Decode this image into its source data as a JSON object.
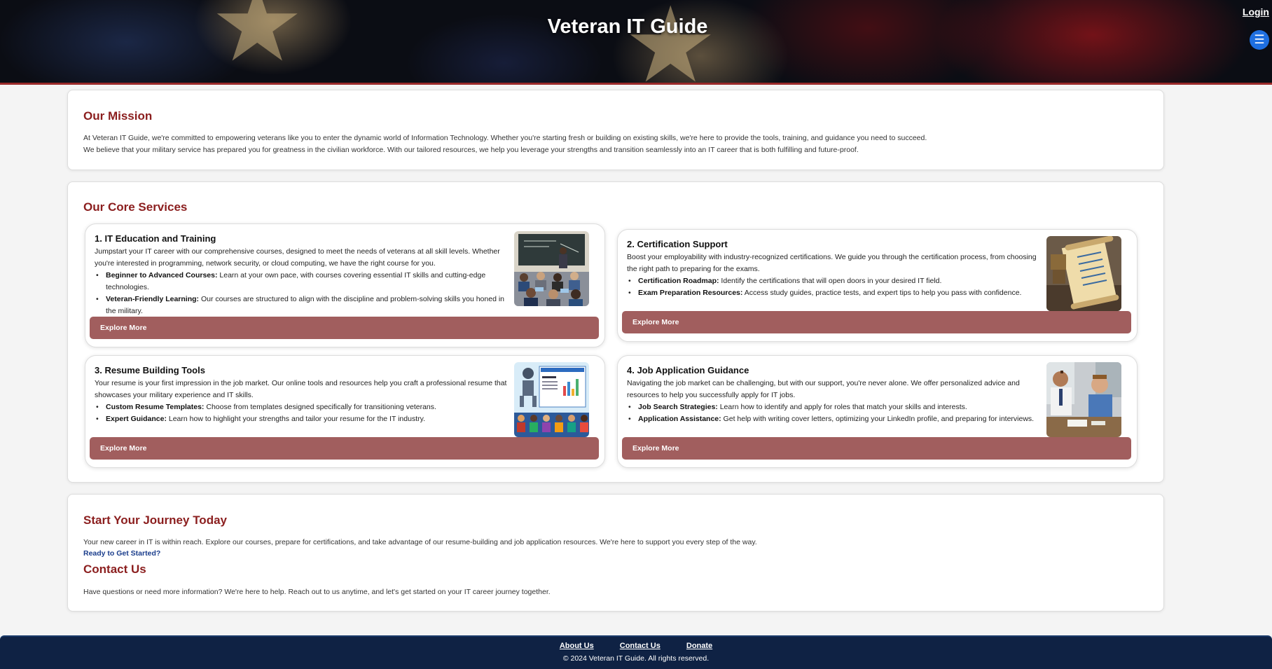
{
  "header": {
    "title": "Veteran IT Guide",
    "login_label": "Login",
    "menu_icon": "menu-icon"
  },
  "mission": {
    "title": "Our Mission",
    "paragraph1": "At Veteran IT Guide, we're committed to empowering veterans like you to enter the dynamic world of Information Technology. Whether you're starting fresh or building on existing skills, we're here to provide the tools, training, and guidance you need to succeed.",
    "paragraph2": "We believe that your military service has prepared you for greatness in the civilian workforce. With our tailored resources, we help you leverage your strengths and transition seamlessly into an IT career that is both fulfilling and future-proof."
  },
  "services": {
    "title": "Our Core Services",
    "items": [
      {
        "title": "1. IT Education and Training",
        "description": "Jumpstart your IT career with our comprehensive courses, designed to meet the needs of veterans at all skill levels. Whether you're interested in programming, network security, or cloud computing, we have the right course for you.",
        "bullets": [
          {
            "label": "Beginner to Advanced Courses:",
            "text": " Learn at your own pace, with courses covering essential IT skills and cutting-edge technologies."
          },
          {
            "label": "Veteran-Friendly Learning:",
            "text": " Our courses are structured to align with the discipline and problem-solving skills you honed in the military."
          }
        ],
        "button": "Explore More"
      },
      {
        "title": "2. Certification Support",
        "description": "Boost your employability with industry-recognized certifications. We guide you through the certification process, from choosing the right path to preparing for the exams.",
        "bullets": [
          {
            "label": "Certification Roadmap:",
            "text": " Identify the certifications that will open doors in your desired IT field."
          },
          {
            "label": "Exam Preparation Resources:",
            "text": " Access study guides, practice tests, and expert tips to help you pass with confidence."
          }
        ],
        "button": "Explore More"
      },
      {
        "title": "3. Resume Building Tools",
        "description": "Your resume is your first impression in the job market. Our online tools and resources help you craft a professional resume that showcases your military experience and IT skills.",
        "bullets": [
          {
            "label": "Custom Resume Templates:",
            "text": " Choose from templates designed specifically for transitioning veterans."
          },
          {
            "label": "Expert Guidance:",
            "text": " Learn how to highlight your strengths and tailor your resume for the IT industry."
          }
        ],
        "button": "Explore More"
      },
      {
        "title": "4. Job Application Guidance",
        "description": "Navigating the job market can be challenging, but with our support, you're never alone. We offer personalized advice and resources to help you successfully apply for IT jobs.",
        "bullets": [
          {
            "label": "Job Search Strategies:",
            "text": " Learn how to identify and apply for roles that match your skills and interests."
          },
          {
            "label": "Application Assistance:",
            "text": " Get help with writing cover letters, optimizing your LinkedIn profile, and preparing for interviews."
          }
        ],
        "button": "Explore More"
      }
    ]
  },
  "journey": {
    "title": "Start Your Journey Today",
    "text": "Your new career in IT is within reach. Explore our courses, prepare for certifications, and take advantage of our resume-building and job application resources. We're here to support you every step of the way.",
    "link": "Ready to Get Started?",
    "contact_title": "Contact Us",
    "contact_text": "Have questions or need more information? We're here to help. Reach out to us anytime, and let's get started on your IT career journey together."
  },
  "footer": {
    "links": [
      "About Us",
      "Contact Us",
      "Donate"
    ],
    "copyright": "© 2024 Veteran IT Guide. All rights reserved."
  }
}
